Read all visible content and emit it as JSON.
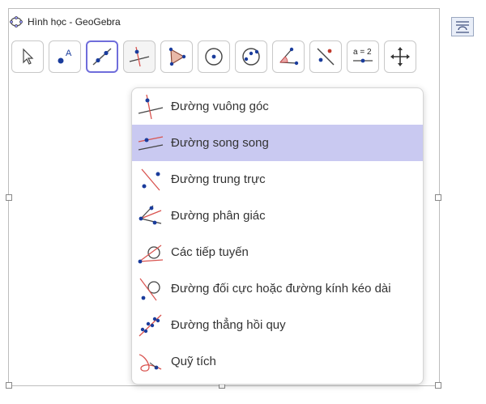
{
  "window": {
    "title": "Hình học - GeoGebra"
  },
  "toolbar": {
    "tools": [
      {
        "name": "move",
        "icon": "arrow-cursor-icon"
      },
      {
        "name": "point",
        "icon": "point-icon"
      },
      {
        "name": "line",
        "icon": "line-icon"
      },
      {
        "name": "perpendicular",
        "icon": "perpendicular-line-icon"
      },
      {
        "name": "polygon",
        "icon": "polygon-icon"
      },
      {
        "name": "circle",
        "icon": "circle-center-point-icon"
      },
      {
        "name": "circle-three-points",
        "icon": "circle-three-points-icon"
      },
      {
        "name": "angle",
        "icon": "angle-icon"
      },
      {
        "name": "reflect",
        "icon": "reflect-icon"
      },
      {
        "name": "slider",
        "icon": "slider-icon",
        "label": "a = 2"
      },
      {
        "name": "move-graphics",
        "icon": "move-view-icon"
      }
    ]
  },
  "menu": {
    "items": [
      {
        "label": "Đường vuông góc",
        "icon": "perpendicular-line-icon"
      },
      {
        "label": "Đường song song",
        "icon": "parallel-line-icon",
        "selected": true
      },
      {
        "label": "Đường trung trực",
        "icon": "perpendicular-bisector-icon"
      },
      {
        "label": "Đường phân giác",
        "icon": "angle-bisector-icon"
      },
      {
        "label": "Các tiếp tuyến",
        "icon": "tangents-icon"
      },
      {
        "label": "Đường đối cực hoặc đường kính kéo dài",
        "icon": "polar-diameter-icon"
      },
      {
        "label": "Đường thẳng hồi quy",
        "icon": "regression-line-icon"
      },
      {
        "label": "Quỹ tích",
        "icon": "locus-icon"
      }
    ]
  },
  "colors": {
    "accent": "#6f6ddb",
    "selected_bg": "#c9c9f1",
    "red_line": "#d9534f",
    "point": "#1a3c9c"
  }
}
